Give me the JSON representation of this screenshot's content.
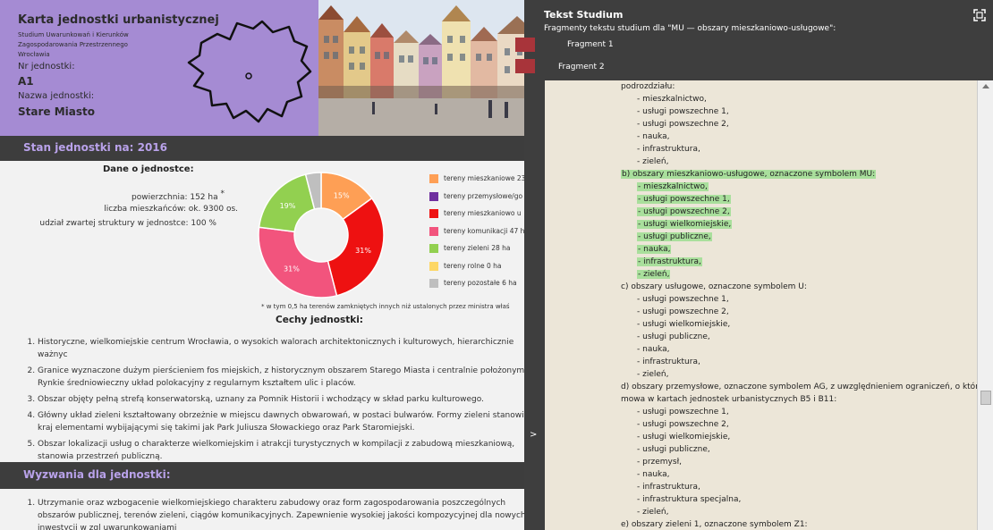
{
  "card": {
    "title": "Karta jednostki urbanistycznej",
    "subtitle": "Studium Uwarunkowań i Kierunków Zagospodarowania Przestrzennego Wrocławia",
    "unit_no_label": "Nr jednostki:",
    "unit_no": "A1",
    "unit_name_label": "Nazwa jednostki:",
    "unit_name": "Stare Miasto",
    "state_heading": "Stan jednostki na: 2016",
    "data_heading": "Dane o jednostce:",
    "stats": [
      {
        "label": "powierzchnia: 152 ha",
        "mark": "*"
      },
      {
        "label": "liczba mieszkańców: ok. 9300 os."
      },
      {
        "label": "udział zwartej struktury w jednostce: 100 %"
      }
    ],
    "footnote": "* w tym 0,5 ha terenów zamkniętych innych niż ustalonych przez ministra właś",
    "features_heading": "Cechy jednostki:",
    "features": [
      "Historyczne, wielkomiejskie centrum Wrocławia, o wysokich walorach architektonicznych i kulturowych, hierarchicznie ważnyc",
      "Granice wyznaczone dużym pierścieniem fos miejskich, z historycznym obszarem Starego Miasta i centralnie położonym Rynkie średniowieczny układ polokacyjny z regularnym kształtem ulic i placów.",
      "Obszar objęty pełną strefą konserwatorską, uznany za Pomnik Historii i wchodzący w skład parku kulturowego.",
      "Główny układ zieleni kształtowany obrzeżnie w miejscu dawnych obwarowań, w postaci bulwarów. Formy zieleni stanowią kraj elementami wybijającymi się takimi jak Park Juliusza Słowackiego oraz Park Staromiejski.",
      "Obszar lokalizacji usług o charakterze wielkomiejskim i atrakcji turystycznych w kompilacji z zabudową mieszkaniową, stanowia przestrzeń publiczną."
    ],
    "challenges_heading": "Wyzwania dla jednostki:",
    "challenges": [
      "Utrzymanie oraz wzbogacenie wielkomiejskiego charakteru zabudowy oraz form zagospodarowania poszczególnych obszarów publicznej, terenów zieleni, ciągów komunikacyjnych. Zapewnienie wysokiej jakości kompozycyjnej dla nowych inwestycji w zgl uwarunkowaniami"
    ]
  },
  "chart_data": {
    "type": "pie",
    "donut": true,
    "slices": [
      {
        "name": "tereny mieszkaniowe 23",
        "value": 15,
        "label": "15%",
        "color": "#fe9f55"
      },
      {
        "name": "tereny przemysłowe/go",
        "value": 0,
        "label": "",
        "color": "#6f2f9f"
      },
      {
        "name": "tereny mieszkaniowo u",
        "value": 31,
        "label": "31%",
        "color": "#ee1111"
      },
      {
        "name": "tereny komunikacji 47 h",
        "value": 31,
        "label": "31%",
        "color": "#f2547d"
      },
      {
        "name": "tereny zieleni 28 ha",
        "value": 19,
        "label": "19%",
        "color": "#92d050"
      },
      {
        "name": "tereny rolne 0 ha",
        "value": 0,
        "label": "",
        "color": "#fdd765"
      },
      {
        "name": "tereny pozostałe 6 ha",
        "value": 4,
        "label": "",
        "color": "#bfbfbf"
      }
    ]
  },
  "panel": {
    "title": "Tekst Studium",
    "subtitle": "Fragmenty tekstu studium dla \"MU — obszary mieszkaniowo-usługowe\":",
    "fragments": [
      "Fragment 1",
      "Fragment 2"
    ],
    "collapse": ">",
    "lines": [
      {
        "t": "podrozdziału:",
        "ind": false,
        "hl": false
      },
      {
        "t": "- mieszkalnictwo,",
        "ind": true,
        "hl": false
      },
      {
        "t": "- usługi powszechne 1,",
        "ind": true,
        "hl": false
      },
      {
        "t": "- usługi powszechne 2,",
        "ind": true,
        "hl": false
      },
      {
        "t": "- nauka,",
        "ind": true,
        "hl": false
      },
      {
        "t": "- infrastruktura,",
        "ind": true,
        "hl": false
      },
      {
        "t": "- zieleń,",
        "ind": true,
        "hl": false
      },
      {
        "t": "b) obszary mieszkaniowo-usługowe, oznaczone symbolem MU:",
        "ind": false,
        "hl": true
      },
      {
        "t": "- mieszkalnictwo,",
        "ind": true,
        "hl": true
      },
      {
        "t": "- usługi powszechne 1,",
        "ind": true,
        "hl": true
      },
      {
        "t": "- usługi powszechne 2,",
        "ind": true,
        "hl": true
      },
      {
        "t": "- usługi wielkomiejskie,",
        "ind": true,
        "hl": true
      },
      {
        "t": "- usługi publiczne,",
        "ind": true,
        "hl": true
      },
      {
        "t": "- nauka,",
        "ind": true,
        "hl": true
      },
      {
        "t": "- infrastruktura,",
        "ind": true,
        "hl": true
      },
      {
        "t": "- zieleń,",
        "ind": true,
        "hl": true
      },
      {
        "t": "c) obszary usługowe, oznaczone symbolem U:",
        "ind": false,
        "hl": false
      },
      {
        "t": "- usługi powszechne 1,",
        "ind": true,
        "hl": false
      },
      {
        "t": "- usługi powszechne 2,",
        "ind": true,
        "hl": false
      },
      {
        "t": "- usługi wielkomiejskie,",
        "ind": true,
        "hl": false
      },
      {
        "t": "- usługi publiczne,",
        "ind": true,
        "hl": false
      },
      {
        "t": "- nauka,",
        "ind": true,
        "hl": false
      },
      {
        "t": "- infrastruktura,",
        "ind": true,
        "hl": false
      },
      {
        "t": "- zieleń,",
        "ind": true,
        "hl": false
      },
      {
        "t": "d) obszary przemysłowe, oznaczone symbolem AG, z uwzględnieniem ograniczeń, o których",
        "ind": false,
        "hl": false
      },
      {
        "t": "mowa w kartach jednostek urbanistycznych B5 i B11:",
        "ind": false,
        "hl": false
      },
      {
        "t": "- usługi powszechne 1,",
        "ind": true,
        "hl": false
      },
      {
        "t": "- usługi powszechne 2,",
        "ind": true,
        "hl": false
      },
      {
        "t": "- usługi wielkomiejskie,",
        "ind": true,
        "hl": false
      },
      {
        "t": "- usługi publiczne,",
        "ind": true,
        "hl": false
      },
      {
        "t": "- przemysł,",
        "ind": true,
        "hl": false
      },
      {
        "t": "- nauka,",
        "ind": true,
        "hl": false
      },
      {
        "t": "- infrastruktura,",
        "ind": true,
        "hl": false
      },
      {
        "t": "- infrastruktura specjalna,",
        "ind": true,
        "hl": false
      },
      {
        "t": "- zieleń,",
        "ind": true,
        "hl": false
      },
      {
        "t": "e) obszary zieleni 1, oznaczone symbolem Z1:",
        "ind": false,
        "hl": false
      }
    ]
  }
}
